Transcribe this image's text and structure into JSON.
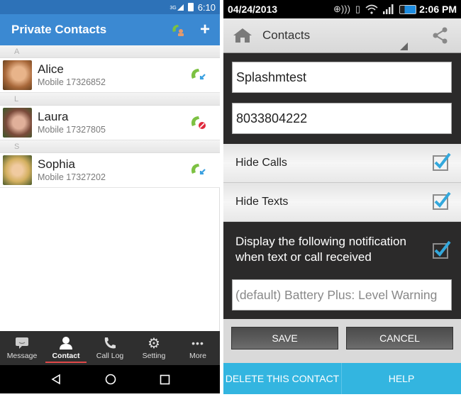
{
  "left": {
    "status": {
      "network": "3G",
      "time": "6:10"
    },
    "appbar": {
      "title": "Private Contacts",
      "contact_icon": "contact-phone-icon",
      "add_icon": "plus-icon",
      "add_label": "+"
    },
    "sections": [
      {
        "letter": "A",
        "contacts": [
          {
            "name": "Alice",
            "number": "Mobile 17326852",
            "call_status": "incoming",
            "avatar_color": "#b07a4a"
          }
        ]
      },
      {
        "letter": "L",
        "contacts": [
          {
            "name": "Laura",
            "number": "Mobile 17327805",
            "call_status": "blocked",
            "avatar_color": "#6a4a3a"
          }
        ]
      },
      {
        "letter": "S",
        "contacts": [
          {
            "name": "Sophia",
            "number": "Mobile 17327202",
            "call_status": "incoming",
            "avatar_color": "#c9a860"
          }
        ]
      }
    ],
    "tabs": [
      {
        "label": "Message",
        "icon": "message-icon",
        "active": false
      },
      {
        "label": "Contact",
        "icon": "person-icon",
        "active": true
      },
      {
        "label": "Call Log",
        "icon": "phone-icon",
        "active": false
      },
      {
        "label": "Setting",
        "icon": "gear-icon",
        "active": false
      },
      {
        "label": "More",
        "icon": "more-icon",
        "active": false
      }
    ],
    "nav": [
      "back",
      "home",
      "recents"
    ],
    "colors": {
      "appbar": "#3b89d2",
      "status": "#2d72b8",
      "active_tab_underline": "#e04848",
      "phone_green": "#7cc142"
    }
  },
  "right": {
    "status": {
      "date": "04/24/2013",
      "time": "2:06 PM"
    },
    "actionbar": {
      "title": "Contacts"
    },
    "name_field": {
      "value": "Splashmtest"
    },
    "phone_field": {
      "value": "8033804222"
    },
    "options": [
      {
        "label": "Hide Calls",
        "checked": true
      },
      {
        "label": "Hide Texts",
        "checked": true
      }
    ],
    "notification": {
      "label": "Display the following notification when text or call received",
      "checked": true,
      "tone_value": "(default) Battery Plus: Level Warning"
    },
    "buttons": {
      "save": "SAVE",
      "cancel": "CANCEL",
      "delete": "DELETE THIS CONTACT",
      "help": "HELP"
    },
    "colors": {
      "check": "#33a8dc",
      "blue_bar": "#33b5e0"
    }
  }
}
